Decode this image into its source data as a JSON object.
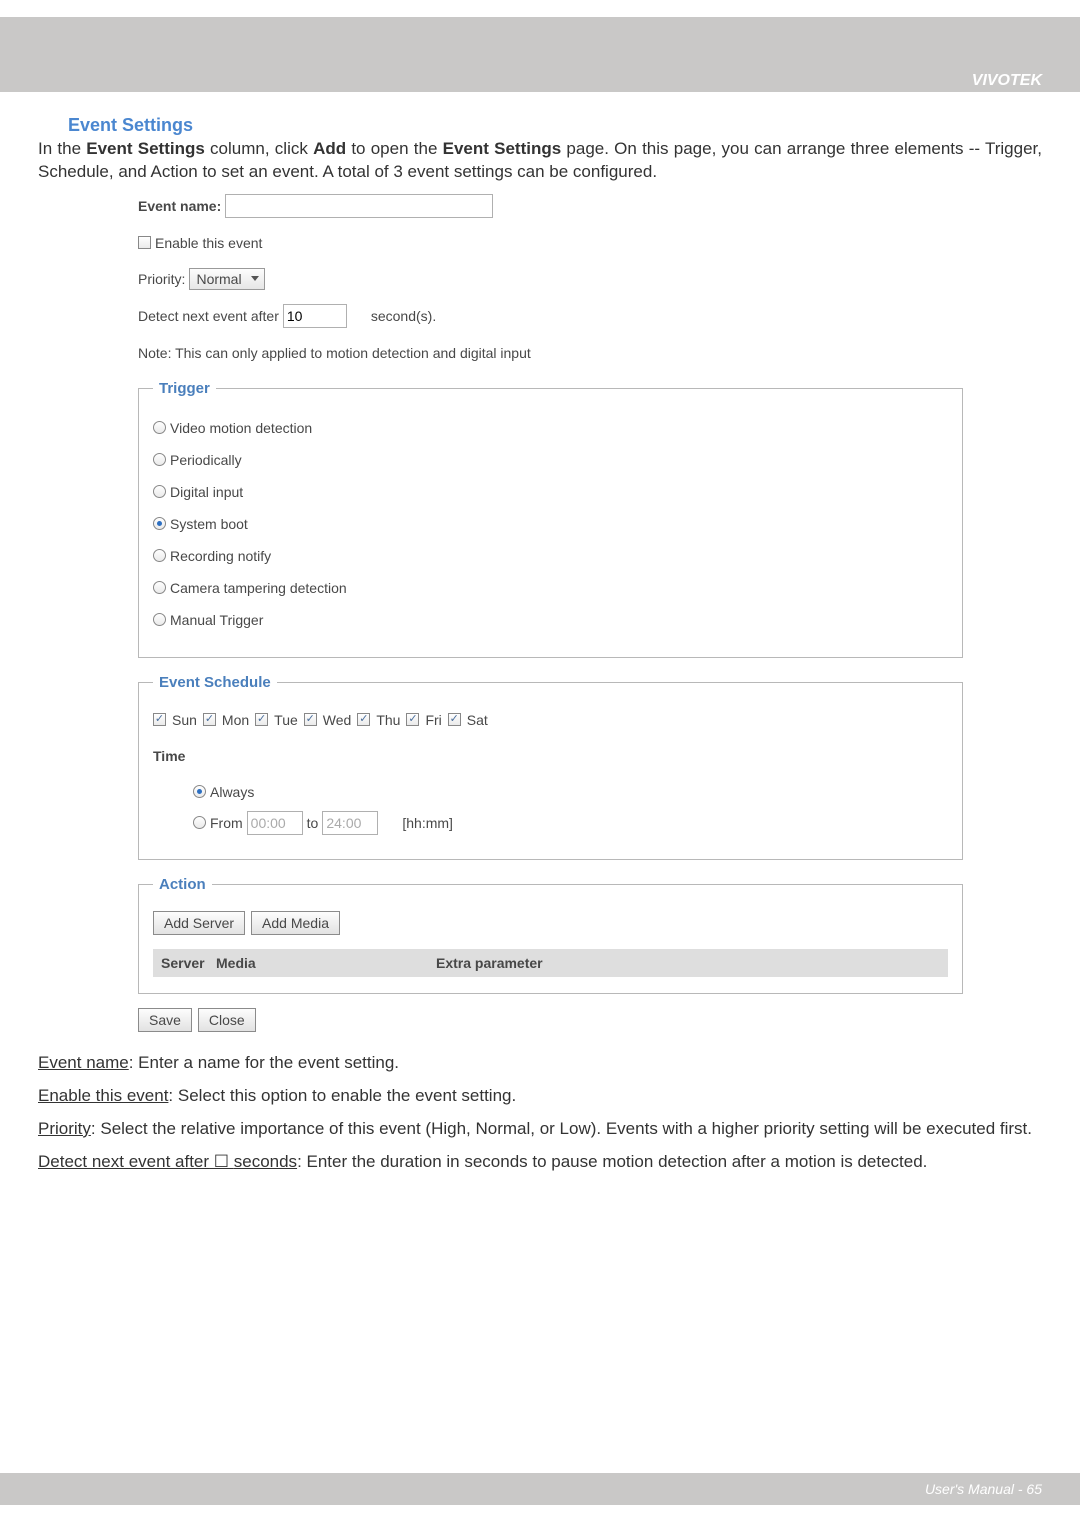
{
  "brand": "VIVOTEK",
  "section_title": "Event Settings",
  "intro_parts": {
    "p1": "In the ",
    "b1": "Event Settings",
    "p2": " column, click ",
    "b2": "Add",
    "p3": " to open the ",
    "b3": "Event Settings",
    "p4": " page. On this page, you can arrange three elements -- Trigger, Schedule, and Action to set an event. A total of 3 event settings can be configured."
  },
  "form": {
    "event_name_label": "Event name:",
    "event_name_value": "",
    "enable_label": "Enable this event",
    "enable_checked": false,
    "priority_label": "Priority:",
    "priority_value": "Normal",
    "detect_prefix": "Detect next event after",
    "detect_value": "10",
    "detect_suffix": "second(s).",
    "note": "Note: This can only applied to motion detection and digital input"
  },
  "trigger": {
    "legend": "Trigger",
    "options": [
      {
        "label": "Video motion detection",
        "selected": false
      },
      {
        "label": "Periodically",
        "selected": false
      },
      {
        "label": "Digital input",
        "selected": false
      },
      {
        "label": "System boot",
        "selected": true
      },
      {
        "label": "Recording notify",
        "selected": false
      },
      {
        "label": "Camera tampering detection",
        "selected": false
      },
      {
        "label": "Manual Trigger",
        "selected": false
      }
    ]
  },
  "schedule": {
    "legend": "Event Schedule",
    "days": [
      {
        "label": "Sun",
        "checked": true
      },
      {
        "label": "Mon",
        "checked": true
      },
      {
        "label": "Tue",
        "checked": true
      },
      {
        "label": "Wed",
        "checked": true
      },
      {
        "label": "Thu",
        "checked": true
      },
      {
        "label": "Fri",
        "checked": true
      },
      {
        "label": "Sat",
        "checked": true
      }
    ],
    "time_label": "Time",
    "always_label": "Always",
    "always_selected": true,
    "from_label": "From",
    "from_value": "00:00",
    "to_label": "to",
    "to_value": "24:00",
    "hhmm": "[hh:mm]"
  },
  "action": {
    "legend": "Action",
    "add_server": "Add Server",
    "add_media": "Add Media",
    "col_server": "Server",
    "col_media": "Media",
    "col_extra": "Extra parameter"
  },
  "buttons": {
    "save": "Save",
    "close": "Close"
  },
  "explain": {
    "ev_u": "Event name",
    "ev_t": ": Enter a name for the event setting.",
    "en_u": "Enable this event",
    "en_t": ": Select this option to enable the event setting.",
    "pr_u": "Priority",
    "pr_t": ": Select the relative importance of this event (High, Normal, or Low). Events with a higher priority setting will be executed first.",
    "de_u": "Detect next event after",
    "de_sq": " ☐ ",
    "de_u2": "seconds",
    "de_t": ": Enter the duration in seconds to pause motion detection after a motion is detected."
  },
  "footer": "User's Manual - 65"
}
